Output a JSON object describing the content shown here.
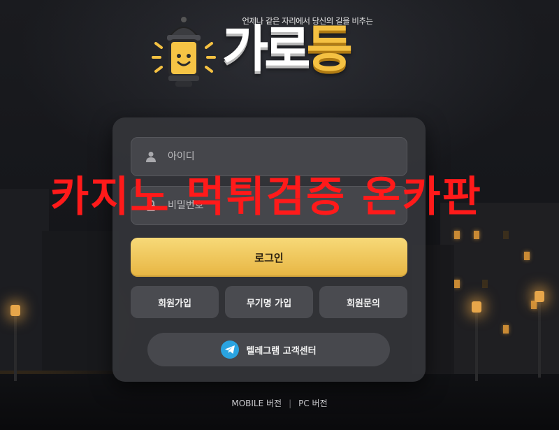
{
  "brand": {
    "tagline": "언제나 같은 자리에서 당신의 길을 비추는",
    "logo_part1": "가로",
    "logo_part2": "등",
    "colors": {
      "white": "#ffffff",
      "yellow": "#f5c142"
    }
  },
  "login": {
    "id_placeholder": "아이디",
    "password_placeholder": "비밀번호",
    "id_icon": "user-icon",
    "password_icon": "lock-icon",
    "login_label": "로그인",
    "accent": "#efc55a"
  },
  "actions": {
    "signup": "회원가입",
    "anonymous_signup": "무기명 가입",
    "inquiry": "회원문의"
  },
  "telegram": {
    "label": "텔레그램 고객센터",
    "icon": "telegram-icon",
    "color": "#2aa3e0"
  },
  "overlay_text": "카지노 먹튀검증 온카판",
  "footer": {
    "mobile": "MOBILE 버전",
    "separator": "|",
    "pc": "PC 버전"
  }
}
